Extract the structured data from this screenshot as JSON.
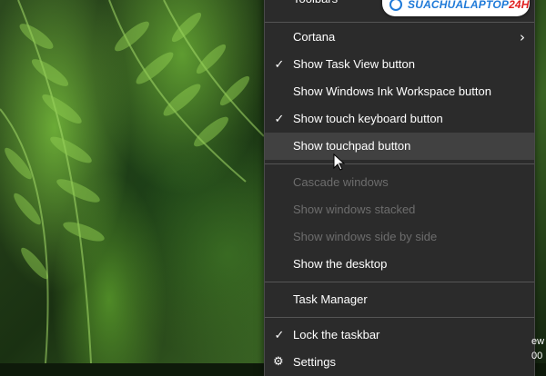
{
  "menu": {
    "items": [
      {
        "label": "Toolbars",
        "checked": false,
        "disabled": false,
        "submenu": true
      },
      {
        "label": "Cortana",
        "checked": false,
        "disabled": false,
        "submenu": true
      },
      {
        "label": "Show Task View button",
        "checked": true,
        "disabled": false
      },
      {
        "label": "Show Windows Ink Workspace button",
        "checked": false,
        "disabled": false
      },
      {
        "label": "Show touch keyboard button",
        "checked": true,
        "disabled": false
      },
      {
        "label": "Show touchpad button",
        "checked": false,
        "disabled": false,
        "hovered": true
      },
      {
        "label": "Cascade windows",
        "checked": false,
        "disabled": true
      },
      {
        "label": "Show windows stacked",
        "checked": false,
        "disabled": true
      },
      {
        "label": "Show windows side by side",
        "checked": false,
        "disabled": true
      },
      {
        "label": "Show the desktop",
        "checked": false,
        "disabled": false
      },
      {
        "label": "Task Manager",
        "checked": false,
        "disabled": false
      },
      {
        "label": "Lock the taskbar",
        "checked": true,
        "disabled": false
      },
      {
        "label": "Settings",
        "checked": false,
        "disabled": false,
        "icon": "gear-icon"
      }
    ],
    "check_glyph": "✓",
    "chevron_glyph": "›",
    "gear_glyph": "⚙"
  },
  "watermark": {
    "text_blue": "SUACHUALAPTOP",
    "text_red": "24H"
  },
  "edge": {
    "line1": "ew",
    "line2": "00"
  },
  "colors": {
    "menu_bg": "#2b2b2b",
    "hover_bg": "#414141",
    "disabled_text": "#6d6d6d",
    "separator": "#555555",
    "wallpaper": "#3a6424"
  }
}
